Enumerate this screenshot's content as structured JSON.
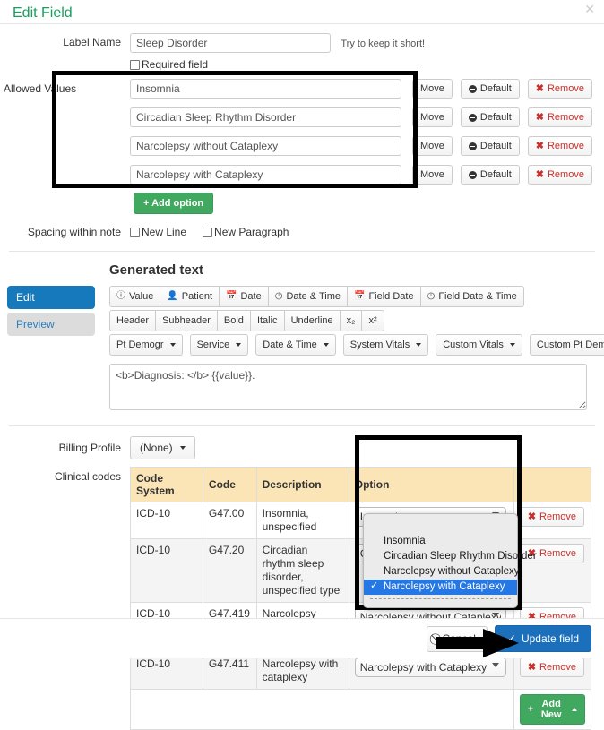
{
  "header": {
    "title": "Edit Field",
    "close_label": "✕"
  },
  "label_name": {
    "label": "Label Name",
    "value": "Sleep Disorder",
    "hint": "Try to keep it short!"
  },
  "required_field": {
    "label": "Required field",
    "checked": false
  },
  "allowed_values": {
    "label": "Allowed Values",
    "rows": [
      {
        "value": "Insomnia",
        "move": "Move",
        "default": "Default",
        "remove": "Remove"
      },
      {
        "value": "Circadian Sleep Rhythm Disorder",
        "move": "Move",
        "default": "Default",
        "remove": "Remove"
      },
      {
        "value": "Narcolepsy without Cataplexy",
        "move": "Move",
        "default": "Default",
        "remove": "Remove"
      },
      {
        "value": "Narcolepsy with Cataplexy",
        "move": "Move",
        "default": "Default",
        "remove": "Remove"
      }
    ],
    "add_option": "Add option"
  },
  "spacing": {
    "label": "Spacing within note",
    "new_line": "New Line",
    "new_paragraph": "New Paragraph"
  },
  "generated_text": {
    "title": "Generated text",
    "tabs": {
      "edit": "Edit",
      "preview": "Preview"
    },
    "toolbar_row1": [
      {
        "label": "Value",
        "icon": "info-circle-icon"
      },
      {
        "label": "Patient",
        "icon": "user-icon"
      },
      {
        "label": "Date",
        "icon": "calendar-icon"
      },
      {
        "label": "Date & Time",
        "icon": "clock-icon"
      },
      {
        "label": "Field Date",
        "icon": "calendar-icon"
      },
      {
        "label": "Field Date & Time",
        "icon": "clock-icon"
      }
    ],
    "toolbar_row2": [
      "Header",
      "Subheader",
      "Bold",
      "Italic",
      "Underline",
      "x₂",
      "x²"
    ],
    "toolbar_row3": [
      "Pt Demogr",
      "Service",
      "Date & Time",
      "System Vitals",
      "Custom Vitals",
      "Custom Pt Demogr"
    ],
    "content": "<b>Diagnosis: </b> {{value}}."
  },
  "billing": {
    "label": "Billing Profile",
    "selected": "(None)"
  },
  "clinical_codes": {
    "label": "Clinical codes",
    "columns": [
      "Code System",
      "Code",
      "Description",
      "Option",
      ""
    ],
    "rows": [
      {
        "system": "ICD-10",
        "code": "G47.00",
        "description": "Insomnia, unspecified",
        "option": "Insomnia",
        "remove": "Remove"
      },
      {
        "system": "ICD-10",
        "code": "G47.20",
        "description": "Circadian rhythm sleep disorder, unspecified type",
        "option": "Circadian Sleep Rhythm Disorder",
        "remove": "Remove"
      },
      {
        "system": "ICD-10",
        "code": "G47.419",
        "description": "Narcolepsy without cataplexy",
        "option": "Narcolepsy without Cataplexy",
        "remove": "Remove"
      },
      {
        "system": "ICD-10",
        "code": "G47.411",
        "description": "Narcolepsy with cataplexy",
        "option": "Narcolepsy with Cataplexy",
        "remove": "Remove"
      }
    ],
    "add_new": "Add New"
  },
  "dropdown_popup": {
    "options": [
      "Insomnia",
      "Circadian Sleep Rhythm Disorder",
      "Narcolepsy without Cataplexy",
      "Narcolepsy with Cataplexy"
    ],
    "selected": "Narcolepsy with Cataplexy"
  },
  "footer": {
    "cancel": "Cancel",
    "update": "Update field"
  },
  "colors": {
    "title_green": "#16a05d",
    "primary_blue": "#1b6fbb",
    "success_green": "#41a85f",
    "danger_red": "#c9302c",
    "table_header": "#fbe5b6",
    "highlight_select": "#2577e3"
  }
}
